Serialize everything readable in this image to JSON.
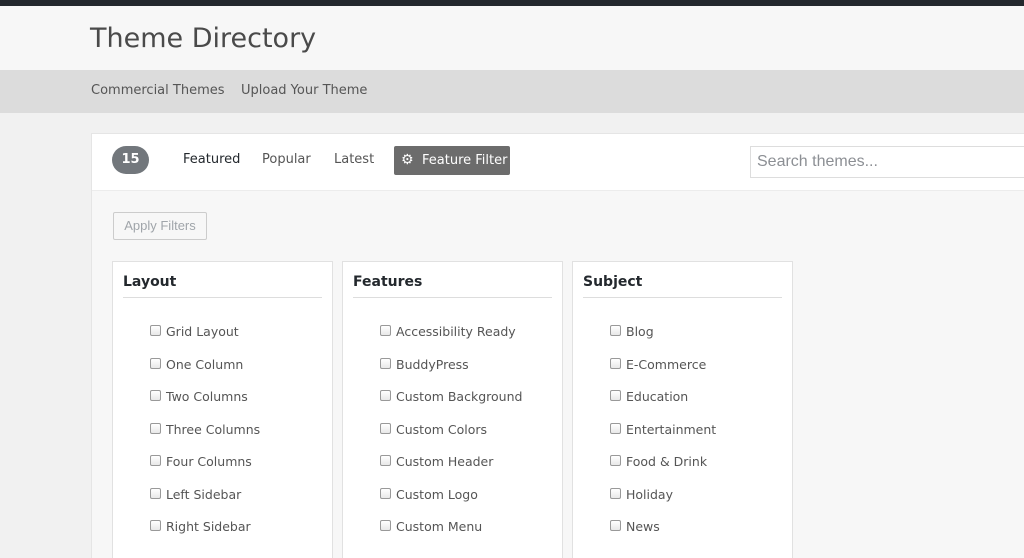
{
  "header": {
    "title": "Theme Directory"
  },
  "subnav": {
    "items": [
      "Commercial Themes",
      "Upload Your Theme"
    ]
  },
  "filter_bar": {
    "count": "15",
    "tabs": [
      "Featured",
      "Popular",
      "Latest"
    ],
    "feature_filter_label": "Feature Filter",
    "search_placeholder": "Search themes..."
  },
  "apply_filters_label": "Apply Filters",
  "groups": [
    {
      "title": "Layout",
      "options": [
        "Grid Layout",
        "One Column",
        "Two Columns",
        "Three Columns",
        "Four Columns",
        "Left Sidebar",
        "Right Sidebar"
      ]
    },
    {
      "title": "Features",
      "options": [
        "Accessibility Ready",
        "BuddyPress",
        "Custom Background",
        "Custom Colors",
        "Custom Header",
        "Custom Logo",
        "Custom Menu"
      ]
    },
    {
      "title": "Subject",
      "options": [
        "Blog",
        "E-Commerce",
        "Education",
        "Entertainment",
        "Food & Drink",
        "Holiday",
        "News"
      ]
    }
  ],
  "colors": {
    "top_bar": "#23282d",
    "count_badge": "#72777c",
    "feature_filter_button": "#6c6c6c"
  },
  "icons": {
    "feature_filter": "gear-icon"
  }
}
